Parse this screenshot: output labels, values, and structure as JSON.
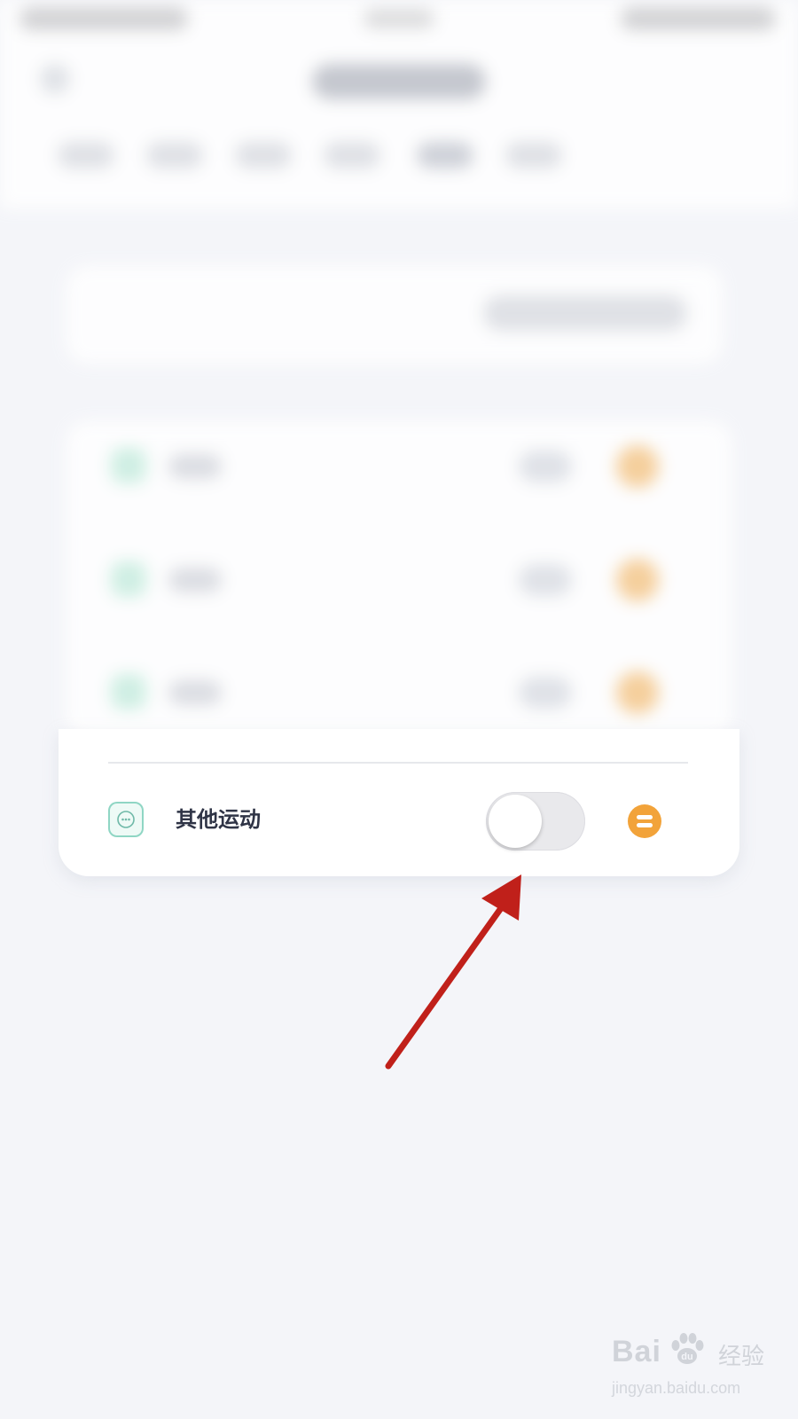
{
  "activity": {
    "label": "其他运动",
    "enabled": false,
    "icon": "more-dots-icon",
    "reorder_icon": "drag-handle-icon"
  },
  "colors": {
    "background": "#f4f5f9",
    "accent_orange": "#f2a33a",
    "icon_teal": "#8fd6c4",
    "annotation_red": "#c0201a",
    "toggle_off": "#e9e9ec"
  },
  "annotation": {
    "type": "arrow",
    "target": "activity-toggle"
  },
  "watermark": {
    "logo": "Bai",
    "logo_suffix": "du",
    "text": "经验",
    "url": "jingyan.baidu.com"
  }
}
